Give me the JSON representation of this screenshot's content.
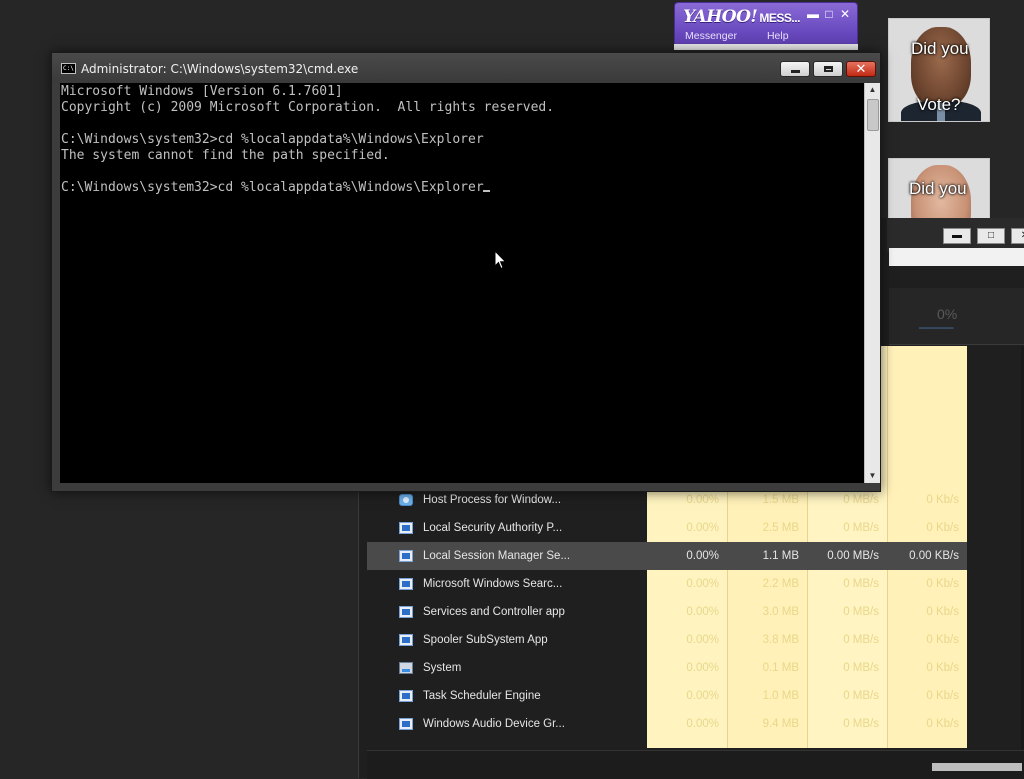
{
  "yahoo": {
    "logo": "YAHOO!",
    "logo_suffix": "MESS...",
    "controls": {
      "minimize": "▬",
      "maximize": "□",
      "close": "✕"
    },
    "menu": [
      "Messenger",
      "Help"
    ]
  },
  "photos": [
    {
      "caption_lines": [
        "Did you",
        "Vote?"
      ]
    },
    {
      "caption_lines": [
        "Did you"
      ]
    }
  ],
  "task_manager": {
    "header_pct": "0%",
    "title_controls": {
      "minimize": "▬",
      "maximize": "□",
      "close": "✕"
    },
    "rows": [
      {
        "icon": "gear-icon",
        "name": "Host Process for Window...",
        "cpu": "0.00%",
        "memory": "1.5 MB",
        "disk": "0 MB/s",
        "network": "0 Kb/s",
        "selected": false
      },
      {
        "icon": "app-window-icon",
        "name": "Local Security Authority P...",
        "cpu": "0.00%",
        "memory": "2.5 MB",
        "disk": "0 MB/s",
        "network": "0 Kb/s",
        "selected": false
      },
      {
        "icon": "app-window-icon",
        "name": "Local Session Manager Se...",
        "cpu": "0.00%",
        "memory": "1.1 MB",
        "disk": "0.00 MB/s",
        "network": "0.00 KB/s",
        "selected": true
      },
      {
        "icon": "app-window-icon",
        "name": "Microsoft Windows Searc...",
        "cpu": "0.00%",
        "memory": "2.2 MB",
        "disk": "0 MB/s",
        "network": "0 Kb/s",
        "selected": false
      },
      {
        "icon": "app-window-icon",
        "name": "Services and Controller app",
        "cpu": "0.00%",
        "memory": "3.0 MB",
        "disk": "0 MB/s",
        "network": "0 Kb/s",
        "selected": false
      },
      {
        "icon": "app-window-icon",
        "name": "Spooler SubSystem App",
        "cpu": "0.00%",
        "memory": "3.8 MB",
        "disk": "0 MB/s",
        "network": "0 Kb/s",
        "selected": false
      },
      {
        "icon": "system-icon",
        "name": "System",
        "cpu": "0.00%",
        "memory": "0.1 MB",
        "disk": "0 MB/s",
        "network": "0 Kb/s",
        "selected": false
      },
      {
        "icon": "app-window-icon",
        "name": "Task Scheduler Engine",
        "cpu": "0.00%",
        "memory": "1.0 MB",
        "disk": "0 MB/s",
        "network": "0 Kb/s",
        "selected": false
      },
      {
        "icon": "app-window-icon",
        "name": "Windows Audio Device Gr...",
        "cpu": "0.00%",
        "memory": "9.4 MB",
        "disk": "0 MB/s",
        "network": "0 Kb/s",
        "selected": false
      }
    ]
  },
  "cmd": {
    "title": "Administrator: C:\\Windows\\system32\\cmd.exe",
    "icon_text": "C:\\",
    "controls": {
      "minimize": "minimize",
      "maximize": "maximize",
      "close": "✕"
    },
    "lines": [
      "Microsoft Windows [Version 6.1.7601]",
      "Copyright (c) 2009 Microsoft Corporation.  All rights reserved.",
      "",
      "C:\\Windows\\system32>cd %localappdata%\\Windows\\Explorer",
      "The system cannot find the path specified.",
      "",
      "C:\\Windows\\system32>cd %localappdata%\\Windows\\Explorer"
    ],
    "scroll_up": "▲",
    "scroll_down": "▼"
  }
}
